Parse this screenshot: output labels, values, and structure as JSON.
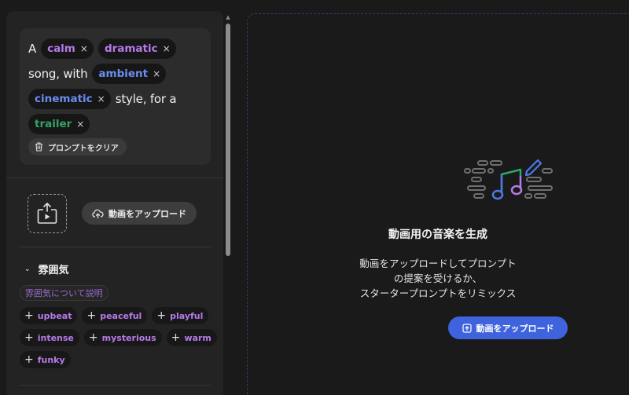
{
  "prompt": {
    "word_a": "A",
    "chip_calm": "calm",
    "chip_dramatic": "dramatic",
    "word_song_with": "song, with",
    "chip_ambient": "ambient",
    "chip_cinematic": "cinematic",
    "word_style_for_a": "style, for a",
    "chip_trailer": "trailer",
    "remove_glyph": "×",
    "clear_label": "プロンプトをクリア"
  },
  "upload_left": {
    "button_label": "動画をアップロード"
  },
  "atmosphere": {
    "title": "雰囲気",
    "describe_placeholder": "雰囲気について説明",
    "tags": [
      "upbeat",
      "peaceful",
      "playful",
      "intense",
      "mysterious",
      "warm",
      "funky"
    ]
  },
  "main": {
    "title": "動画用の音楽を生成",
    "desc_line1": "動画をアップロードしてプロンプト",
    "desc_line2": "の提案を受けるか、",
    "desc_line3": "スタータープロンプトをリミックス",
    "upload_label": "動画をアップロード"
  },
  "colors": {
    "purple": "#b77ae8",
    "blue": "#6b8df0",
    "green": "#36a165",
    "accent": "#3e63dd"
  },
  "icons": [
    "trash-icon",
    "upload-video-icon",
    "cloud-upload-icon",
    "chevron-down-icon",
    "plus-icon",
    "music-illustration-icon",
    "upload-icon"
  ]
}
